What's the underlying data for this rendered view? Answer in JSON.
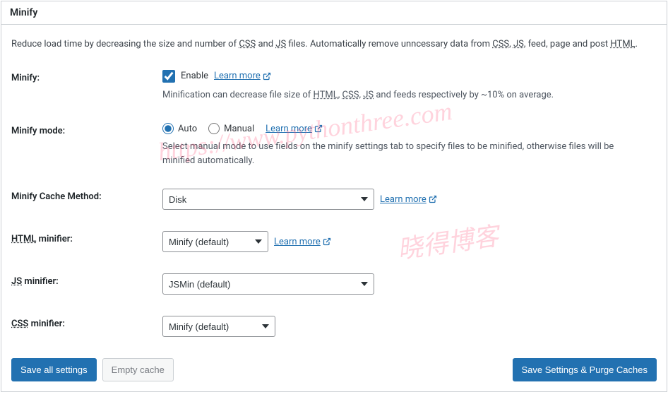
{
  "header": {
    "title": "Minify"
  },
  "intro": {
    "prefix": "Reduce load time by decreasing the size and number of ",
    "css": "CSS",
    "and": " and ",
    "js": "JS",
    "mid": " files. Automatically remove unncessary data from ",
    "css2": "CSS",
    "sep": ", ",
    "js2": "JS",
    "mid2": ", feed, page and post ",
    "html": "HTML",
    "end": "."
  },
  "rows": {
    "minify": {
      "label": "Minify:",
      "enable": "Enable",
      "learn_more": "Learn more",
      "desc_pre": "Minification can decrease file size of ",
      "html": "HTML",
      "sep": ", ",
      "css": "CSS",
      "js": "JS",
      "desc_post": " and feeds respectively by ~10% on average."
    },
    "mode": {
      "label": "Minify mode:",
      "auto": "Auto",
      "manual": "Manual",
      "learn_more": "Learn more",
      "desc": "Select manual mode to use fields on the minify settings tab to specify files to be minified, otherwise files will be minified automatically."
    },
    "cache_method": {
      "label": "Minify Cache Method:",
      "value": "Disk",
      "learn_more": "Learn more"
    },
    "html_minifier": {
      "label_abbr": "HTML",
      "label_post": " minifier:",
      "value": "Minify (default)",
      "learn_more": "Learn more"
    },
    "js_minifier": {
      "label_abbr": "JS",
      "label_post": " minifier:",
      "value": "JSMin (default)"
    },
    "css_minifier": {
      "label_abbr": "CSS",
      "label_post": " minifier:",
      "value": "Minify (default)"
    }
  },
  "buttons": {
    "save_all": "Save all settings",
    "empty_cache": "Empty cache",
    "save_purge": "Save Settings & Purge Caches"
  },
  "watermark": {
    "wm1": "https://www.pythonthree.com",
    "wm2": "晓得博客"
  }
}
